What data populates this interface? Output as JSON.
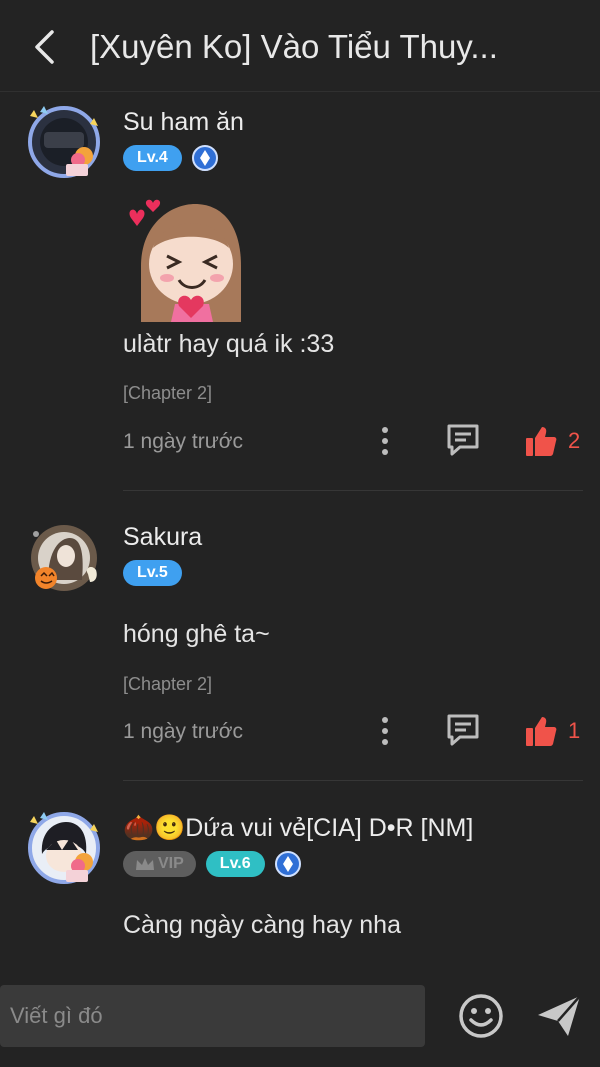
{
  "header": {
    "title": "[Xuyên Ko] Vào Tiểu Thuy..."
  },
  "comments": [
    {
      "username": "Su ham ăn",
      "level": "Lv.4",
      "text": "ulàtr hay quá ik :33",
      "chapter": "[Chapter 2]",
      "time": "1 ngày trước",
      "likes": "2"
    },
    {
      "username": "Sakura",
      "level": "Lv.5",
      "text": "hóng ghê ta~",
      "chapter": "[Chapter 2]",
      "time": "1 ngày trước",
      "likes": "1"
    },
    {
      "username": "🌰🙂Dứa vui vẻ[CIA] D•R [NM]",
      "vip": "VIP",
      "level": "Lv.6",
      "text": "Càng ngày càng hay nha"
    }
  ],
  "footer": {
    "input_placeholder": "Viết gì đó"
  },
  "colors": {
    "background": "#232323",
    "like_red": "#f0534a",
    "level_blue": "#3fa0f0",
    "level_teal": "#2fbfc4"
  }
}
